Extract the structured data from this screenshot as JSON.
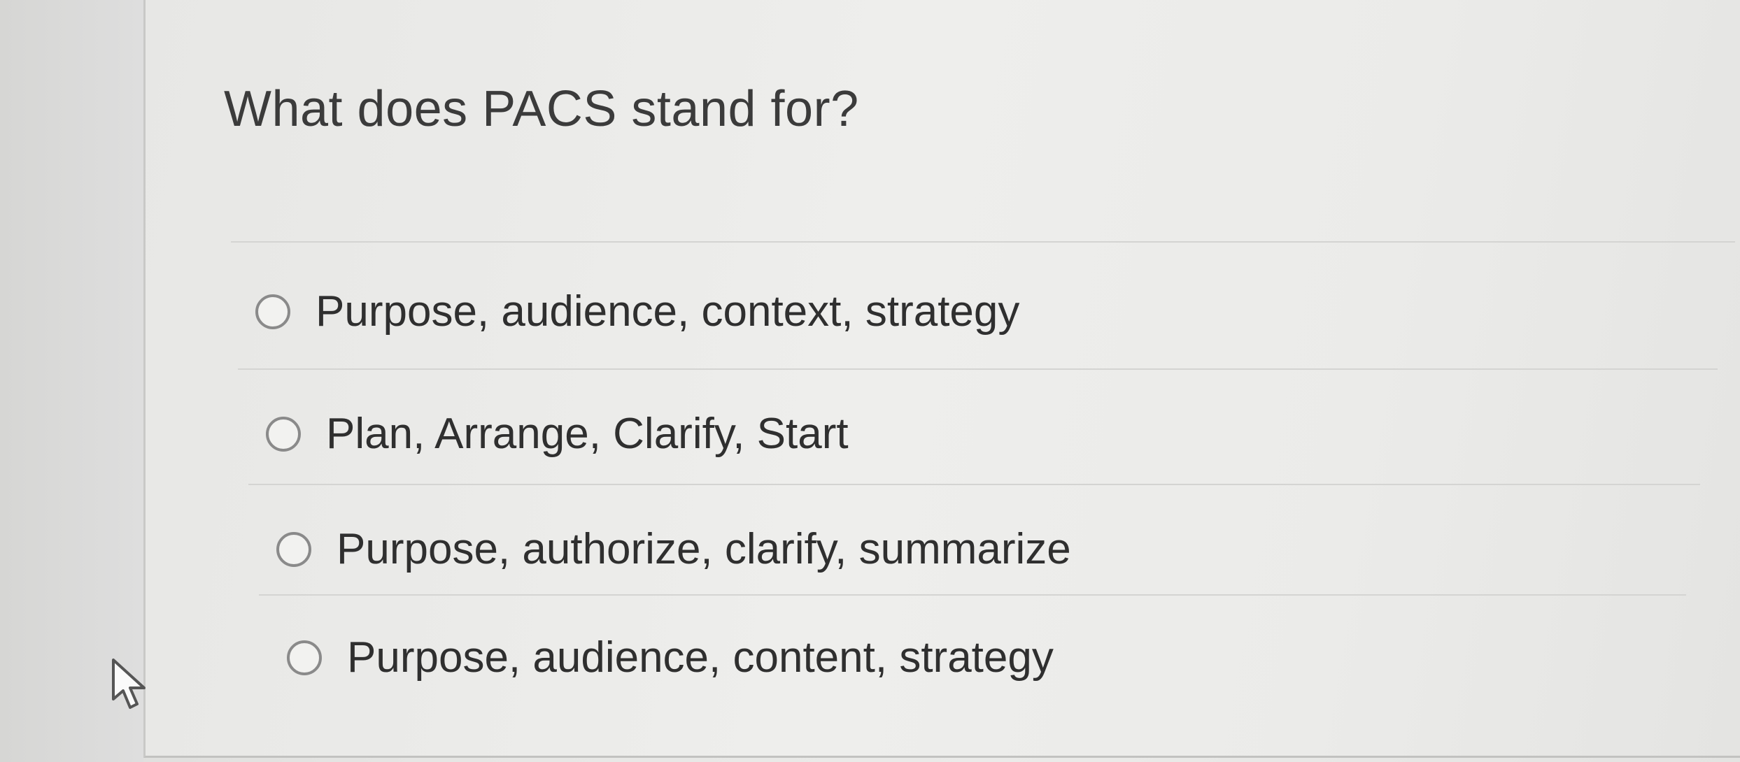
{
  "question": {
    "text": "What does PACS stand for?"
  },
  "options": [
    {
      "label": "Purpose, audience, context, strategy"
    },
    {
      "label": "Plan, Arrange, Clarify, Start"
    },
    {
      "label": "Purpose, authorize, clarify, summarize"
    },
    {
      "label": "Purpose, audience, content, strategy"
    }
  ],
  "cursor": {
    "icon": "arrow-pointer-icon"
  },
  "colors": {
    "text": "#2f2f2f",
    "radio_border": "#8a8a8a",
    "background": "#ebebe9"
  }
}
